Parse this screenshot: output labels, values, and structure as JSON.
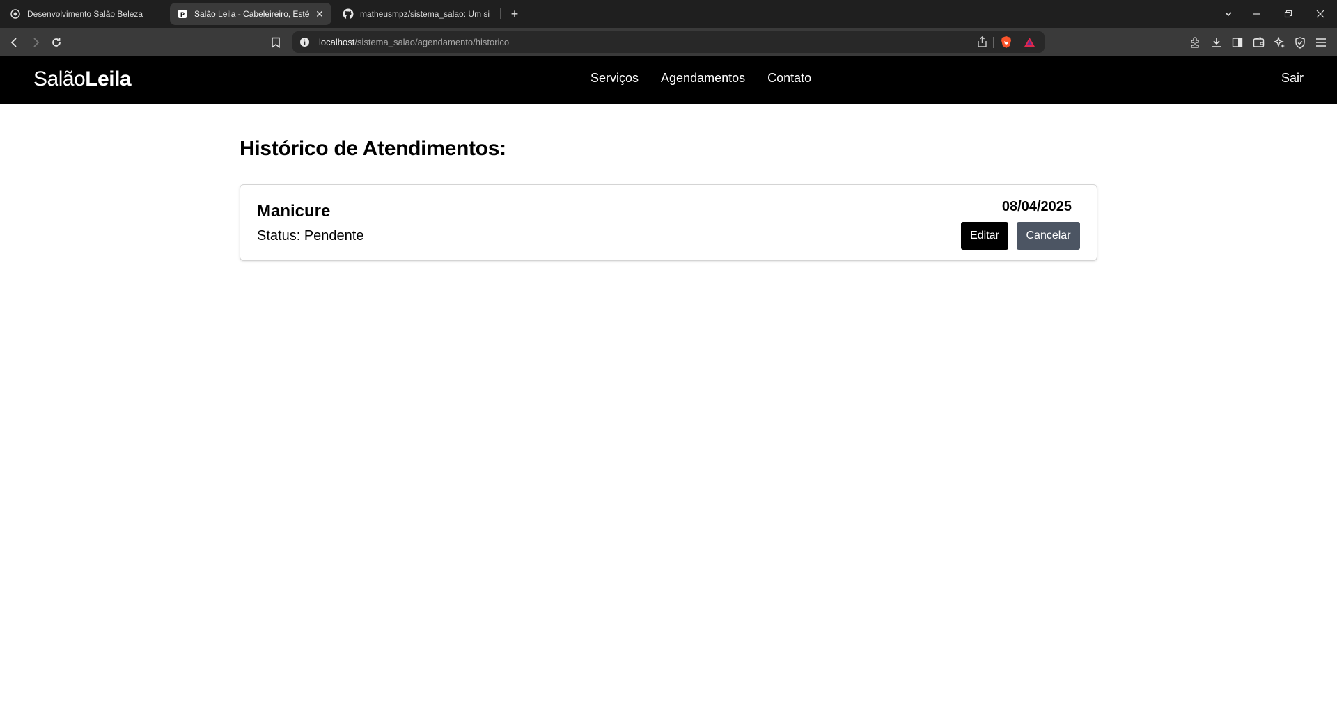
{
  "browser": {
    "tabs": [
      {
        "title": "Desenvolvimento Salão Beleza",
        "icon": "circle-logo-icon"
      },
      {
        "title": "Salão Leila - Cabeleireiro, Estéti",
        "icon": "page-favicon-icon"
      },
      {
        "title": "matheusmpz/sistema_salao: Um sist",
        "icon": "github-icon"
      }
    ],
    "url_host": "localhost",
    "url_path": "/sistema_salao/agendamento/historico"
  },
  "site": {
    "brand_light": "Salão",
    "brand_bold": "Leila",
    "nav": [
      "Serviços",
      "Agendamentos",
      "Contato"
    ],
    "logout": "Sair"
  },
  "main": {
    "heading": "Histórico de Atendimentos:",
    "appointments": [
      {
        "service": "Manicure",
        "status": "Status: Pendente",
        "date": "08/04/2025",
        "edit_label": "Editar",
        "cancel_label": "Cancelar"
      }
    ]
  },
  "colors": {
    "navbar": "#000000",
    "edit_button": "#000000",
    "cancel_button": "#4c5563"
  }
}
